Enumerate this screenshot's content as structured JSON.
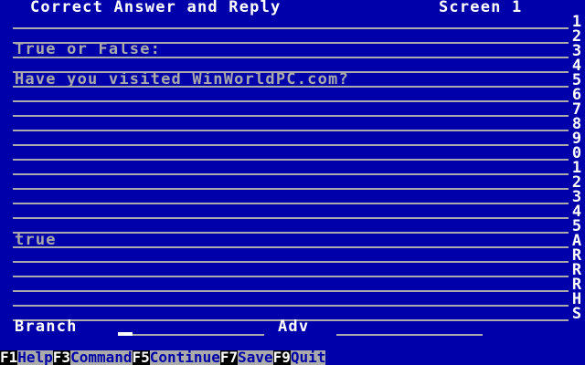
{
  "header": {
    "title": "Correct Answer and Reply",
    "screen_label": "Screen 1"
  },
  "content": {
    "question_type": "True or False:",
    "question_text": "Have you visited WinWorldPC.com?",
    "answer_text": "true"
  },
  "row_markers": [
    "1",
    "2",
    "3",
    "4",
    "5",
    "6",
    "7",
    "8",
    "9",
    "0",
    "1",
    "2",
    "3",
    "4",
    "5",
    "A",
    "R",
    "R",
    "R",
    "H",
    "S"
  ],
  "fields": {
    "branch_label": "Branch",
    "adv_label": "Adv"
  },
  "function_keys": [
    {
      "key": "F1",
      "label": "Help"
    },
    {
      "key": "F3",
      "label": "Command"
    },
    {
      "key": "F5",
      "label": "Continue"
    },
    {
      "key": "F7",
      "label": "Save"
    },
    {
      "key": "F9",
      "label": "Quit"
    }
  ],
  "colors": {
    "background": "#0000aa",
    "text": "#ffffff",
    "dim_text": "#aaaaaa",
    "fkey_bar": "#aaaaaa"
  }
}
